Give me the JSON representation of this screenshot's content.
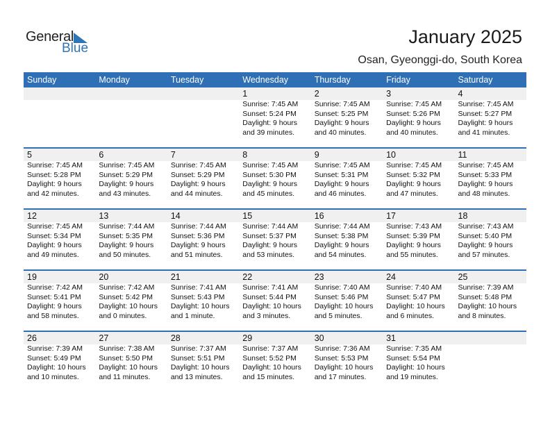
{
  "brand": {
    "word1": "General",
    "word2": "Blue",
    "accent": "#2e6fb5"
  },
  "header": {
    "title": "January 2025",
    "location": "Osan, Gyeonggi-do, South Korea"
  },
  "weekdays": [
    "Sunday",
    "Monday",
    "Tuesday",
    "Wednesday",
    "Thursday",
    "Friday",
    "Saturday"
  ],
  "weeks": [
    [
      null,
      null,
      null,
      {
        "day": "1",
        "sunrise": "Sunrise: 7:45 AM",
        "sunset": "Sunset: 5:24 PM",
        "daylight1": "Daylight: 9 hours",
        "daylight2": "and 39 minutes."
      },
      {
        "day": "2",
        "sunrise": "Sunrise: 7:45 AM",
        "sunset": "Sunset: 5:25 PM",
        "daylight1": "Daylight: 9 hours",
        "daylight2": "and 40 minutes."
      },
      {
        "day": "3",
        "sunrise": "Sunrise: 7:45 AM",
        "sunset": "Sunset: 5:26 PM",
        "daylight1": "Daylight: 9 hours",
        "daylight2": "and 40 minutes."
      },
      {
        "day": "4",
        "sunrise": "Sunrise: 7:45 AM",
        "sunset": "Sunset: 5:27 PM",
        "daylight1": "Daylight: 9 hours",
        "daylight2": "and 41 minutes."
      }
    ],
    [
      {
        "day": "5",
        "sunrise": "Sunrise: 7:45 AM",
        "sunset": "Sunset: 5:28 PM",
        "daylight1": "Daylight: 9 hours",
        "daylight2": "and 42 minutes."
      },
      {
        "day": "6",
        "sunrise": "Sunrise: 7:45 AM",
        "sunset": "Sunset: 5:29 PM",
        "daylight1": "Daylight: 9 hours",
        "daylight2": "and 43 minutes."
      },
      {
        "day": "7",
        "sunrise": "Sunrise: 7:45 AM",
        "sunset": "Sunset: 5:29 PM",
        "daylight1": "Daylight: 9 hours",
        "daylight2": "and 44 minutes."
      },
      {
        "day": "8",
        "sunrise": "Sunrise: 7:45 AM",
        "sunset": "Sunset: 5:30 PM",
        "daylight1": "Daylight: 9 hours",
        "daylight2": "and 45 minutes."
      },
      {
        "day": "9",
        "sunrise": "Sunrise: 7:45 AM",
        "sunset": "Sunset: 5:31 PM",
        "daylight1": "Daylight: 9 hours",
        "daylight2": "and 46 minutes."
      },
      {
        "day": "10",
        "sunrise": "Sunrise: 7:45 AM",
        "sunset": "Sunset: 5:32 PM",
        "daylight1": "Daylight: 9 hours",
        "daylight2": "and 47 minutes."
      },
      {
        "day": "11",
        "sunrise": "Sunrise: 7:45 AM",
        "sunset": "Sunset: 5:33 PM",
        "daylight1": "Daylight: 9 hours",
        "daylight2": "and 48 minutes."
      }
    ],
    [
      {
        "day": "12",
        "sunrise": "Sunrise: 7:45 AM",
        "sunset": "Sunset: 5:34 PM",
        "daylight1": "Daylight: 9 hours",
        "daylight2": "and 49 minutes."
      },
      {
        "day": "13",
        "sunrise": "Sunrise: 7:44 AM",
        "sunset": "Sunset: 5:35 PM",
        "daylight1": "Daylight: 9 hours",
        "daylight2": "and 50 minutes."
      },
      {
        "day": "14",
        "sunrise": "Sunrise: 7:44 AM",
        "sunset": "Sunset: 5:36 PM",
        "daylight1": "Daylight: 9 hours",
        "daylight2": "and 51 minutes."
      },
      {
        "day": "15",
        "sunrise": "Sunrise: 7:44 AM",
        "sunset": "Sunset: 5:37 PM",
        "daylight1": "Daylight: 9 hours",
        "daylight2": "and 53 minutes."
      },
      {
        "day": "16",
        "sunrise": "Sunrise: 7:44 AM",
        "sunset": "Sunset: 5:38 PM",
        "daylight1": "Daylight: 9 hours",
        "daylight2": "and 54 minutes."
      },
      {
        "day": "17",
        "sunrise": "Sunrise: 7:43 AM",
        "sunset": "Sunset: 5:39 PM",
        "daylight1": "Daylight: 9 hours",
        "daylight2": "and 55 minutes."
      },
      {
        "day": "18",
        "sunrise": "Sunrise: 7:43 AM",
        "sunset": "Sunset: 5:40 PM",
        "daylight1": "Daylight: 9 hours",
        "daylight2": "and 57 minutes."
      }
    ],
    [
      {
        "day": "19",
        "sunrise": "Sunrise: 7:42 AM",
        "sunset": "Sunset: 5:41 PM",
        "daylight1": "Daylight: 9 hours",
        "daylight2": "and 58 minutes."
      },
      {
        "day": "20",
        "sunrise": "Sunrise: 7:42 AM",
        "sunset": "Sunset: 5:42 PM",
        "daylight1": "Daylight: 10 hours",
        "daylight2": "and 0 minutes."
      },
      {
        "day": "21",
        "sunrise": "Sunrise: 7:41 AM",
        "sunset": "Sunset: 5:43 PM",
        "daylight1": "Daylight: 10 hours",
        "daylight2": "and 1 minute."
      },
      {
        "day": "22",
        "sunrise": "Sunrise: 7:41 AM",
        "sunset": "Sunset: 5:44 PM",
        "daylight1": "Daylight: 10 hours",
        "daylight2": "and 3 minutes."
      },
      {
        "day": "23",
        "sunrise": "Sunrise: 7:40 AM",
        "sunset": "Sunset: 5:46 PM",
        "daylight1": "Daylight: 10 hours",
        "daylight2": "and 5 minutes."
      },
      {
        "day": "24",
        "sunrise": "Sunrise: 7:40 AM",
        "sunset": "Sunset: 5:47 PM",
        "daylight1": "Daylight: 10 hours",
        "daylight2": "and 6 minutes."
      },
      {
        "day": "25",
        "sunrise": "Sunrise: 7:39 AM",
        "sunset": "Sunset: 5:48 PM",
        "daylight1": "Daylight: 10 hours",
        "daylight2": "and 8 minutes."
      }
    ],
    [
      {
        "day": "26",
        "sunrise": "Sunrise: 7:39 AM",
        "sunset": "Sunset: 5:49 PM",
        "daylight1": "Daylight: 10 hours",
        "daylight2": "and 10 minutes."
      },
      {
        "day": "27",
        "sunrise": "Sunrise: 7:38 AM",
        "sunset": "Sunset: 5:50 PM",
        "daylight1": "Daylight: 10 hours",
        "daylight2": "and 11 minutes."
      },
      {
        "day": "28",
        "sunrise": "Sunrise: 7:37 AM",
        "sunset": "Sunset: 5:51 PM",
        "daylight1": "Daylight: 10 hours",
        "daylight2": "and 13 minutes."
      },
      {
        "day": "29",
        "sunrise": "Sunrise: 7:37 AM",
        "sunset": "Sunset: 5:52 PM",
        "daylight1": "Daylight: 10 hours",
        "daylight2": "and 15 minutes."
      },
      {
        "day": "30",
        "sunrise": "Sunrise: 7:36 AM",
        "sunset": "Sunset: 5:53 PM",
        "daylight1": "Daylight: 10 hours",
        "daylight2": "and 17 minutes."
      },
      {
        "day": "31",
        "sunrise": "Sunrise: 7:35 AM",
        "sunset": "Sunset: 5:54 PM",
        "daylight1": "Daylight: 10 hours",
        "daylight2": "and 19 minutes."
      },
      null
    ]
  ]
}
